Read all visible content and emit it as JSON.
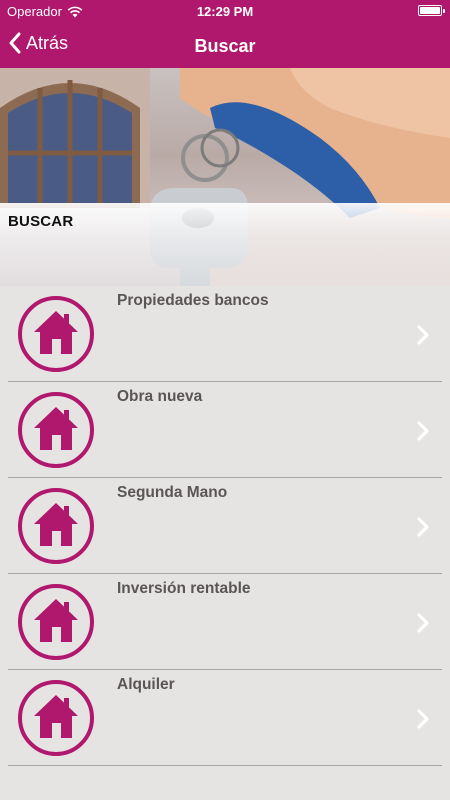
{
  "status_bar": {
    "carrier": "Operador",
    "time": "12:29 PM"
  },
  "nav": {
    "back_label": "Atrás",
    "title": "Buscar"
  },
  "hero": {
    "title": "BUSCAR"
  },
  "colors": {
    "brand": "#b0186e",
    "background": "#e6e3e3",
    "item_text": "#5a5656"
  },
  "list": {
    "items": [
      {
        "label": "Propiedades bancos",
        "icon": "house-icon"
      },
      {
        "label": "Obra nueva",
        "icon": "house-icon"
      },
      {
        "label": "Segunda Mano",
        "icon": "house-icon"
      },
      {
        "label": "Inversión rentable",
        "icon": "house-icon"
      },
      {
        "label": "Alquiler",
        "icon": "house-icon"
      }
    ]
  }
}
